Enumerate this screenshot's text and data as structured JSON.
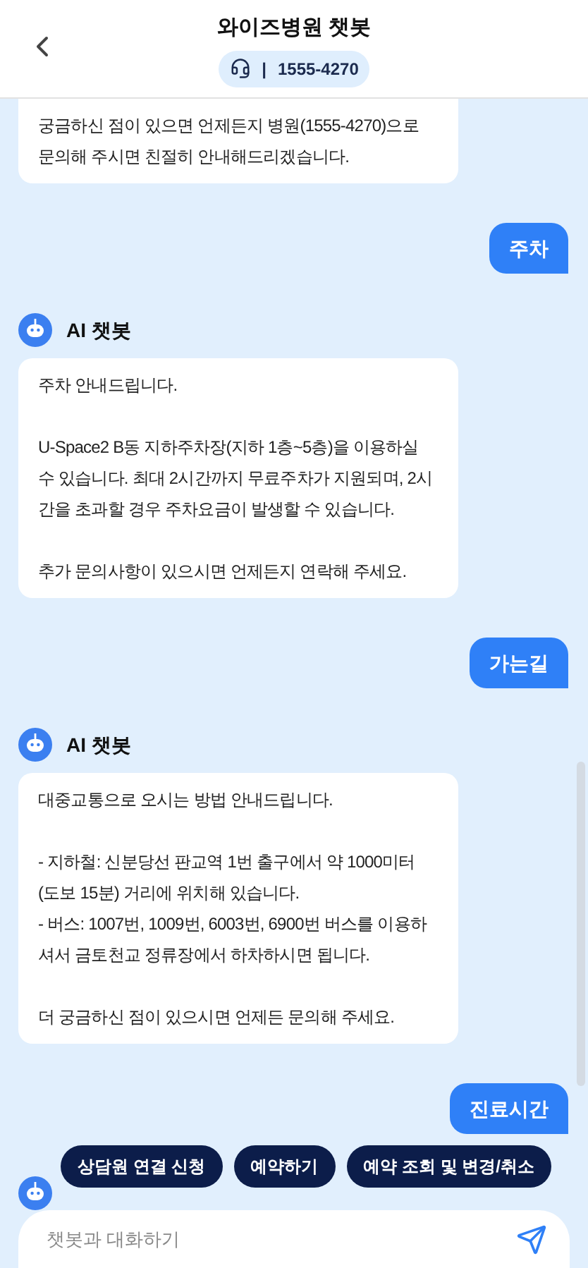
{
  "header": {
    "title": "와이즈병원 챗봇",
    "separator": "|",
    "phone": "1555-4270"
  },
  "messages": [
    {
      "kind": "bot",
      "paragraphs": [
        [
          "궁금하신 점이 있으면 언제든지 병원(1555-4270)으로 문의해 주시면 친절히 안내해드리겠습니다."
        ]
      ]
    },
    {
      "kind": "user",
      "text": "주차"
    },
    {
      "kind": "bot",
      "sender": "AI 챗봇",
      "paragraphs": [
        [
          "주차 안내드립니다."
        ],
        [
          "U-Space2 B동 지하주차장(지하 1층~5층)을 이용하실 수 있습니다. 최대 2시간까지 무료주차가 지원되며, 2시간을 초과할 경우 주차요금이 발생할 수 있습니다."
        ],
        [
          "추가 문의사항이 있으시면 언제든지 연락해 주세요."
        ]
      ]
    },
    {
      "kind": "user",
      "text": "가는길"
    },
    {
      "kind": "bot",
      "sender": "AI 챗봇",
      "paragraphs": [
        [
          "대중교통으로 오시는 방법 안내드립니다."
        ],
        [
          "- 지하철: 신분당선 판교역 1번 출구에서 약 1000미터 (도보 15분) 거리에 위치해 있습니다.",
          "- 버스: 1007번, 1009번, 6003번, 6900번 버스를 이용하셔서 금토천교 정류장에서 하차하시면 됩니다."
        ],
        [
          "더 궁금하신 점이 있으시면 언제든 문의해 주세요."
        ]
      ]
    },
    {
      "kind": "user",
      "text": "진료시간"
    },
    {
      "kind": "bot_partial"
    }
  ],
  "quick_replies": [
    "상담원 연결 신청",
    "예약하기",
    "예약 조회 및 변경/취소"
  ],
  "input": {
    "placeholder": "챗봇과 대화하기"
  }
}
